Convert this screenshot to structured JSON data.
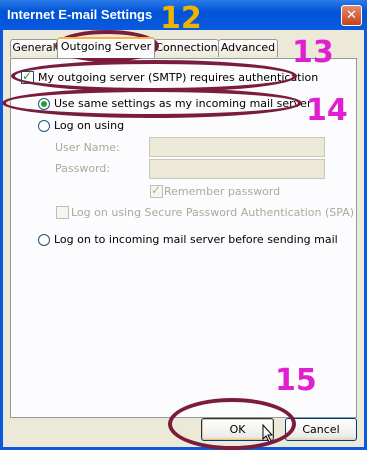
{
  "window": {
    "title": "Internet E-mail Settings",
    "close_glyph": "✕"
  },
  "tabs": [
    {
      "label": "General"
    },
    {
      "label": "Outgoing Server",
      "active": true
    },
    {
      "label": "Connection"
    },
    {
      "label": "Advanced"
    }
  ],
  "outgoing": {
    "smtp_auth_label": "My outgoing server (SMTP) requires authentication",
    "smtp_auth_checked": true,
    "use_same_label": "Use same settings as my incoming mail server",
    "logon_using_label": "Log on using",
    "user_name_label": "User Name:",
    "password_label": "Password:",
    "user_name_value": "",
    "password_value": "",
    "remember_password_label": "Remember password",
    "remember_password_checked": true,
    "spa_label": "Log on using Secure Password Authentication (SPA)",
    "spa_checked": false,
    "logon_incoming_label": "Log on to incoming mail server before sending mail"
  },
  "buttons": {
    "ok": "OK",
    "cancel": "Cancel"
  },
  "annotations": {
    "step_12": "12",
    "step_13": "13",
    "step_14": "14",
    "step_15": "15",
    "ellipse_color": "#7a1c3a",
    "number_color": "#e020d0",
    "number_12_color": "#f0b400"
  }
}
